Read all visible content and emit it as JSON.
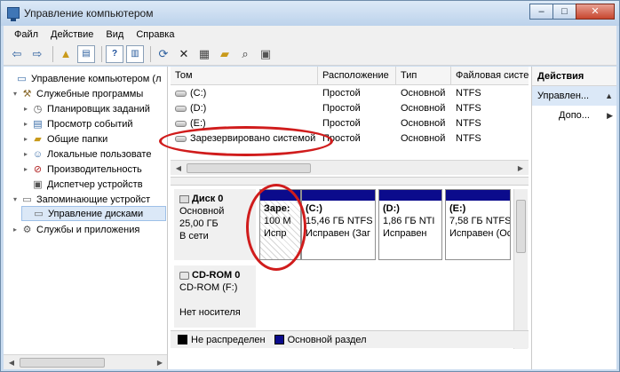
{
  "window": {
    "title": "Управление компьютером"
  },
  "caption": {
    "minimize": "–",
    "maximize": "□",
    "close": "✕"
  },
  "menu": [
    "Файл",
    "Действие",
    "Вид",
    "Справка"
  ],
  "tree": {
    "items": [
      {
        "label": "Управление компьютером (л",
        "icon": "computer-icon",
        "level": 0,
        "twisty": ""
      },
      {
        "label": "Служебные программы",
        "icon": "tools-icon",
        "level": 1,
        "twisty": "▾"
      },
      {
        "label": "Планировщик заданий",
        "icon": "clock-icon",
        "level": 2,
        "twisty": "▸"
      },
      {
        "label": "Просмотр событий",
        "icon": "event-viewer-icon",
        "level": 2,
        "twisty": "▸"
      },
      {
        "label": "Общие папки",
        "icon": "shared-folder-icon",
        "level": 2,
        "twisty": "▸"
      },
      {
        "label": "Локальные пользовате",
        "icon": "users-icon",
        "level": 2,
        "twisty": "▸"
      },
      {
        "label": "Производительность",
        "icon": "performance-icon",
        "level": 2,
        "twisty": "▸"
      },
      {
        "label": "Диспетчер устройств",
        "icon": "device-manager-icon",
        "level": 2,
        "twisty": ""
      },
      {
        "label": "Запоминающие устройст",
        "icon": "storage-icon",
        "level": 1,
        "twisty": "▾"
      },
      {
        "label": "Управление дисками",
        "icon": "disk-management-icon",
        "level": 2,
        "twisty": ""
      },
      {
        "label": "Службы и приложения",
        "icon": "services-icon",
        "level": 1,
        "twisty": "▸"
      }
    ]
  },
  "volumes": {
    "columns": [
      "Том",
      "Расположение",
      "Тип",
      "Файловая систе"
    ],
    "rows": [
      {
        "name": "(C:)",
        "layout": "Простой",
        "type": "Основной",
        "fs": "NTFS"
      },
      {
        "name": "(D:)",
        "layout": "Простой",
        "type": "Основной",
        "fs": "NTFS"
      },
      {
        "name": "(E:)",
        "layout": "Простой",
        "type": "Основной",
        "fs": "NTFS"
      },
      {
        "name": "Зарезервировано системой",
        "layout": "Простой",
        "type": "Основной",
        "fs": "NTFS"
      }
    ]
  },
  "disks": [
    {
      "name": "Диск 0",
      "type": "Основной",
      "size": "25,00 ГБ",
      "status": "В сети",
      "partitions": [
        {
          "label": "Заре:",
          "size": "100 М",
          "status": "Испр"
        },
        {
          "label": "(C:)",
          "size": "15,46 ГБ NTFS",
          "status": "Исправен (Заг"
        },
        {
          "label": "(D:)",
          "size": "1,86 ГБ NTI",
          "status": "Исправен"
        },
        {
          "label": "(E:)",
          "size": "7,58 ГБ NTFS",
          "status": "Исправен (Ос"
        }
      ]
    },
    {
      "name": "CD-ROM 0",
      "type": "CD-ROM (F:)",
      "status": "Нет носителя"
    }
  ],
  "legend": [
    {
      "label": "Не распределен",
      "color": "#000000"
    },
    {
      "label": "Основной раздел",
      "color": "#0b0b8c"
    }
  ],
  "actions": {
    "header": "Действия",
    "selected": "Управлен...",
    "more": "Допо..."
  }
}
